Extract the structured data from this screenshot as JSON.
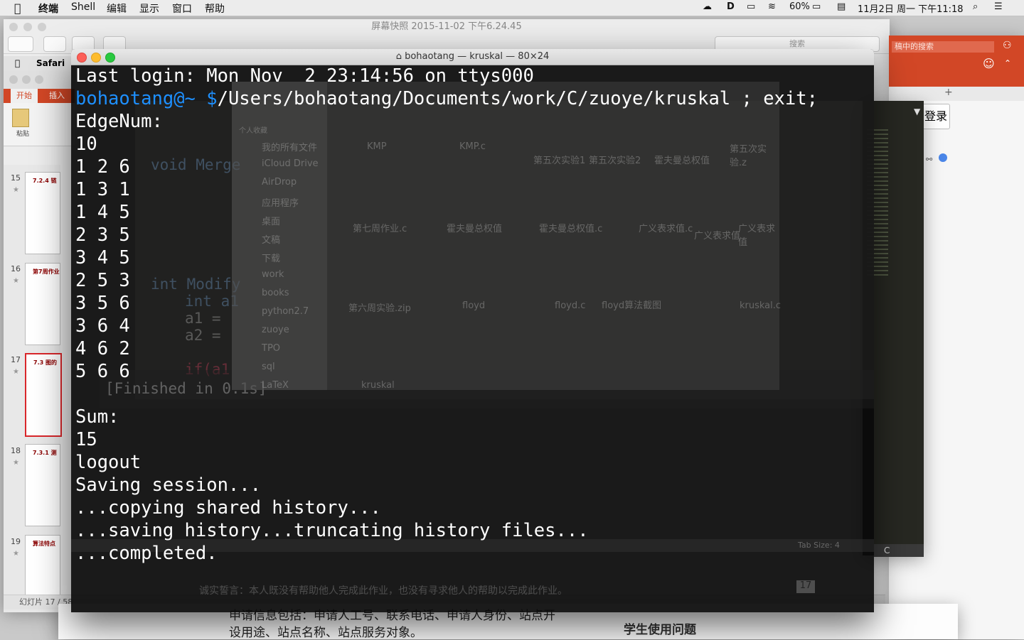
{
  "menubar": {
    "app_name": "终端",
    "menus": [
      "Shell",
      "编辑",
      "显示",
      "窗口",
      "帮助"
    ],
    "battery": "60%",
    "datetime": "11月2日 周一 下午11:18"
  },
  "preview_window": {
    "title": "屏幕快照 2015-11-02 下午6.24.45",
    "search_placeholder": "搜索"
  },
  "safari": {
    "label": "Safari"
  },
  "ppt": {
    "tabs": [
      "开始",
      "插入"
    ],
    "paste_label": "粘贴",
    "slides": [
      {
        "num": "15",
        "title": "7.2.4 链"
      },
      {
        "num": "16",
        "title": "第7周作业"
      },
      {
        "num": "17",
        "title": "7.3 图的"
      },
      {
        "num": "18",
        "title": "7.3.1 测"
      },
      {
        "num": "19",
        "title": "算法特点"
      }
    ],
    "status": "幻灯片 17 / 58",
    "footer_note": "诚实誓言：本人既没有帮助他人完成此作业，也没有寻求他人的帮助以完成此作业。",
    "badge": "17"
  },
  "right_panel": {
    "search_text": "稿中的搜索",
    "login_label": "登录"
  },
  "web_footer": {
    "line1": "申请信息包括：申请人工号、联系电话、申请人身份、站点开",
    "line2": "设用途、站点名称、站点服务对象。",
    "heading": "学生使用问题"
  },
  "finder": {
    "sidebar_header": "个人收藏",
    "sidebar_items": [
      "我的所有文件",
      "iCloud Drive",
      "AirDrop",
      "应用程序",
      "桌面",
      "文稿",
      "下载",
      "work",
      "books",
      "python2.7",
      "zuoye",
      "TPO",
      "sql",
      "LaTeX"
    ],
    "files": [
      "KMP",
      "KMP.c",
      "第五次实验1",
      "第五次实验2",
      "霍夫曼总权值",
      "第五次实验.z",
      "第七周作业.c",
      "霍夫曼总权值",
      "霍夫曼总权值.c",
      "广义表求值.c",
      "广义表求值",
      "广义表求值",
      "第六周实验.zip",
      "floyd",
      "floyd.c",
      "floyd算法截图",
      "kruskal.c",
      "kruskal"
    ]
  },
  "editor": {
    "status_tab": "Tab Size: 4",
    "status_lang": "C",
    "finished": "[Finished in 0.1s]"
  },
  "terminal": {
    "title": "bohaotang — kruskal — 80×24",
    "login_line": "Last login: Mon Nov  2 23:14:56 on ttys000",
    "prompt_user": "bohaotang@~ ",
    "prompt_dollar": "$",
    "command": "/Users/bohaotang/Documents/work/C/zuoye/kruskal ; exit;",
    "lines": [
      "EdgeNum:",
      "10",
      "1 2 6",
      "1 3 1",
      "1 4 5",
      "2 3 5",
      "3 4 5",
      "2 5 3",
      "3 5 6",
      "3 6 4",
      "4 6 2",
      "5 6 6",
      "",
      "Sum:",
      "15",
      "logout",
      "Saving session...",
      "...copying shared history...",
      "...saving history...truncating history files...",
      "...completed."
    ]
  }
}
